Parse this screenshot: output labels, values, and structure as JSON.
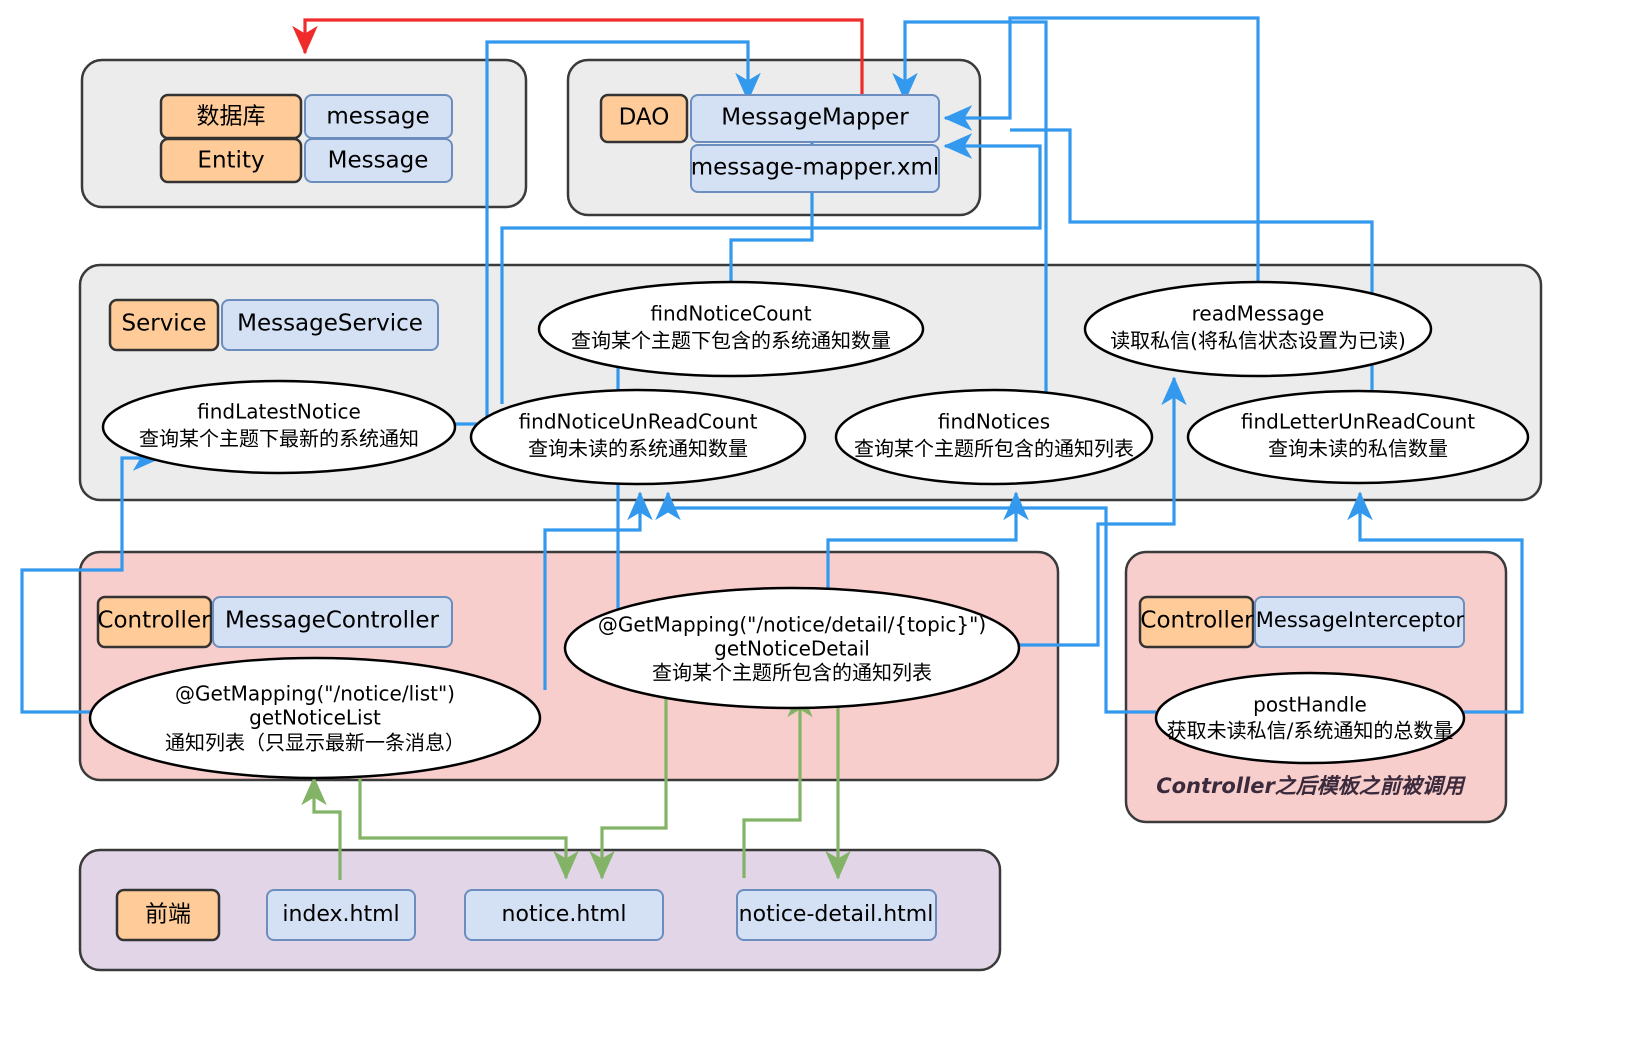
{
  "diagram": {
    "title": "Message module layered architecture",
    "colors": {
      "blue_arrow": "#3399ee",
      "red_arrow": "#ef2b2b",
      "green_arrow": "#82b366",
      "tag_fill": "#ffcc99",
      "box_fill": "#d4e1f5",
      "entity_layer_fill": "#ececec",
      "dao_layer_fill": "#ececec",
      "service_layer_fill": "#ececec",
      "controller_layer_fill": "#f8cecc",
      "frontend_layer_fill": "#e1d5e7"
    }
  },
  "entity_layer": {
    "rows": [
      {
        "tag": "数据库",
        "box": "message"
      },
      {
        "tag": "Entity",
        "box": "Message"
      }
    ]
  },
  "dao_layer": {
    "tag": "DAO",
    "boxes": [
      {
        "label": "MessageMapper"
      },
      {
        "label": "message-mapper.xml"
      }
    ]
  },
  "service_layer": {
    "tag": "Service",
    "class": "MessageService",
    "methods": [
      {
        "name": "findLatestNotice",
        "desc": "查询某个主题下最新的系统通知"
      },
      {
        "name": "findNoticeCount",
        "desc": "查询某个主题下包含的系统通知数量"
      },
      {
        "name": "readMessage",
        "desc": "读取私信(将私信状态设置为已读)"
      },
      {
        "name": "findNoticeUnReadCount",
        "desc": "查询未读的系统通知数量"
      },
      {
        "name": "findNotices",
        "desc": "查询某个主题所包含的通知列表"
      },
      {
        "name": "findLetterUnReadCount",
        "desc": "查询未读的私信数量"
      }
    ]
  },
  "controller_layer": {
    "tag": "Controller",
    "class": "MessageController",
    "handlers": [
      {
        "mapping": "@GetMapping(\"/notice/list\")",
        "method": "getNoticeList",
        "desc": "通知列表（只显示最新一条消息）"
      },
      {
        "mapping": "@GetMapping(\"/notice/detail/{topic}\")",
        "method": "getNoticeDetail",
        "desc": "查询某个主题所包含的通知列表"
      }
    ]
  },
  "interceptor_layer": {
    "tag": "Controller",
    "class": "MessageInterceptor",
    "handler": {
      "method": "postHandle",
      "desc": "获取未读私信/系统通知的总数量"
    },
    "note": "Controller之后模板之前被调用"
  },
  "frontend_layer": {
    "tag": "前端",
    "pages": [
      {
        "label": "index.html"
      },
      {
        "label": "notice.html"
      },
      {
        "label": "notice-detail.html"
      }
    ]
  }
}
